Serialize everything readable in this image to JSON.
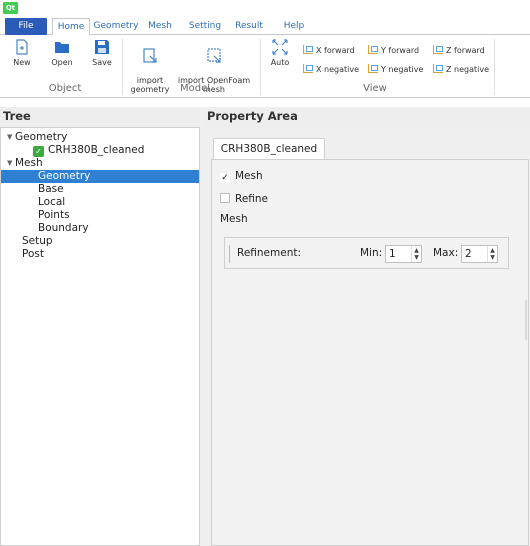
{
  "app": {
    "logo": "Qt"
  },
  "tabs": [
    "File",
    "Home",
    "Geometry",
    "Mesh",
    "Setting",
    "Result",
    "Help"
  ],
  "ribbon": {
    "object_group": {
      "label": "Object",
      "buttons": [
        "New",
        "Open",
        "Save"
      ]
    },
    "model_group": {
      "label": "Model",
      "buttons": [
        "import\ngeometry",
        "import OpenFoam\nmesh"
      ]
    },
    "view_group": {
      "label": "View",
      "auto": "Auto",
      "forward": [
        "X forward",
        "Y forward",
        "Z forward"
      ],
      "negative": [
        "X negative",
        "Y negative",
        "Z negative"
      ]
    }
  },
  "tree": {
    "title": "Tree",
    "items": [
      {
        "label": "Geometry",
        "level": 0,
        "expanded": true
      },
      {
        "label": "CRH380B_cleaned",
        "level": 1,
        "checked": true
      },
      {
        "label": "Mesh",
        "level": 0,
        "expanded": true
      },
      {
        "label": "Geometry",
        "level": 1,
        "selected": true
      },
      {
        "label": "Base",
        "level": 1
      },
      {
        "label": "Local",
        "level": 1
      },
      {
        "label": "Points",
        "level": 1
      },
      {
        "label": "Boundary",
        "level": 1
      },
      {
        "label": "Setup",
        "level": 0
      },
      {
        "label": "Post",
        "level": 0
      }
    ]
  },
  "property": {
    "title": "Property Area",
    "tab": "CRH380B_cleaned",
    "mesh_checkbox": {
      "label": "Mesh",
      "checked": true
    },
    "refine_checkbox": {
      "label": "Refine",
      "checked": false
    },
    "section_label": "Mesh",
    "refinement": {
      "label": "Refinement:",
      "min_label": "Min:",
      "min_value": "1",
      "max_label": "Max:",
      "max_value": "2"
    }
  },
  "colors": {
    "file_tab": "#2a5bb8",
    "selection": "#2f7fd3",
    "check_green": "#3ea83e"
  }
}
